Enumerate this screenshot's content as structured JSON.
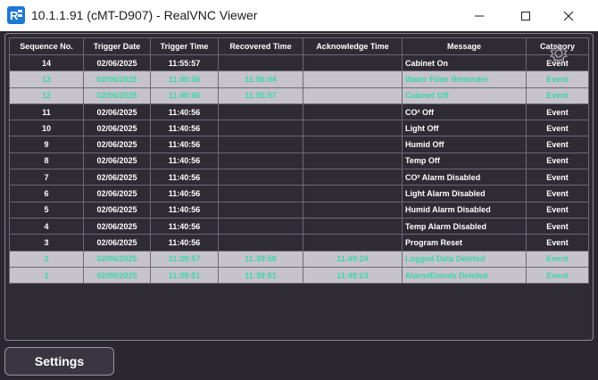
{
  "window": {
    "title": "10.1.1.91 (cMT-D907) - RealVNC Viewer",
    "app_icon": "realvnc-icon"
  },
  "table": {
    "columns": [
      "Sequence No.",
      "Trigger Date",
      "Trigger Time",
      "Recovered Time",
      "Acknowledge Time",
      "Message",
      "Category"
    ],
    "rows": [
      {
        "seq": "14",
        "date": "02/06/2025",
        "trigger": "11:55:57",
        "recovered": "",
        "ack": "",
        "message": "Cabinet On",
        "category": "Event",
        "state": "normal"
      },
      {
        "seq": "13",
        "date": "02/06/2025",
        "trigger": "11:40:56",
        "recovered": "11:56:04",
        "ack": "",
        "message": "Water Filter Reminder",
        "category": "Event",
        "state": "recovered"
      },
      {
        "seq": "12",
        "date": "02/06/2025",
        "trigger": "11:40:56",
        "recovered": "11:55:57",
        "ack": "",
        "message": "Cabinet Off",
        "category": "Event",
        "state": "recovered"
      },
      {
        "seq": "11",
        "date": "02/06/2025",
        "trigger": "11:40:56",
        "recovered": "",
        "ack": "",
        "message": "CO² Off",
        "category": "Event",
        "state": "normal"
      },
      {
        "seq": "10",
        "date": "02/06/2025",
        "trigger": "11:40:56",
        "recovered": "",
        "ack": "",
        "message": "Light Off",
        "category": "Event",
        "state": "normal"
      },
      {
        "seq": "9",
        "date": "02/06/2025",
        "trigger": "11:40:56",
        "recovered": "",
        "ack": "",
        "message": "Humid Off",
        "category": "Event",
        "state": "normal"
      },
      {
        "seq": "8",
        "date": "02/06/2025",
        "trigger": "11:40:56",
        "recovered": "",
        "ack": "",
        "message": "Temp Off",
        "category": "Event",
        "state": "normal"
      },
      {
        "seq": "7",
        "date": "02/06/2025",
        "trigger": "11:40:56",
        "recovered": "",
        "ack": "",
        "message": "CO² Alarm Disabled",
        "category": "Event",
        "state": "normal"
      },
      {
        "seq": "6",
        "date": "02/06/2025",
        "trigger": "11:40:56",
        "recovered": "",
        "ack": "",
        "message": "Light Alarm Disabled",
        "category": "Event",
        "state": "normal"
      },
      {
        "seq": "5",
        "date": "02/06/2025",
        "trigger": "11:40:56",
        "recovered": "",
        "ack": "",
        "message": "Humid Alarm Disabled",
        "category": "Event",
        "state": "normal"
      },
      {
        "seq": "4",
        "date": "02/06/2025",
        "trigger": "11:40:56",
        "recovered": "",
        "ack": "",
        "message": "Temp Alarm Disabled",
        "category": "Event",
        "state": "normal"
      },
      {
        "seq": "3",
        "date": "02/06/2025",
        "trigger": "11:40:56",
        "recovered": "",
        "ack": "",
        "message": "Program Reset",
        "category": "Event",
        "state": "normal"
      },
      {
        "seq": "2",
        "date": "02/06/2025",
        "trigger": "11:39:57",
        "recovered": "11:39:58",
        "ack": "11:49:24",
        "message": "Logged Data Deleted",
        "category": "Event",
        "state": "recovered"
      },
      {
        "seq": "1",
        "date": "02/06/2025",
        "trigger": "11:39:51",
        "recovered": "11:39:51",
        "ack": "11:49:23",
        "message": "Alarm/Events Deleted",
        "category": "Event",
        "state": "recovered"
      }
    ]
  },
  "settings_button": {
    "label": "Settings"
  },
  "colors": {
    "background": "#2b2730",
    "recovered_row_bg": "#c7c3cc",
    "recovered_text": "#3dd6a6",
    "normal_text": "#ffffff"
  }
}
